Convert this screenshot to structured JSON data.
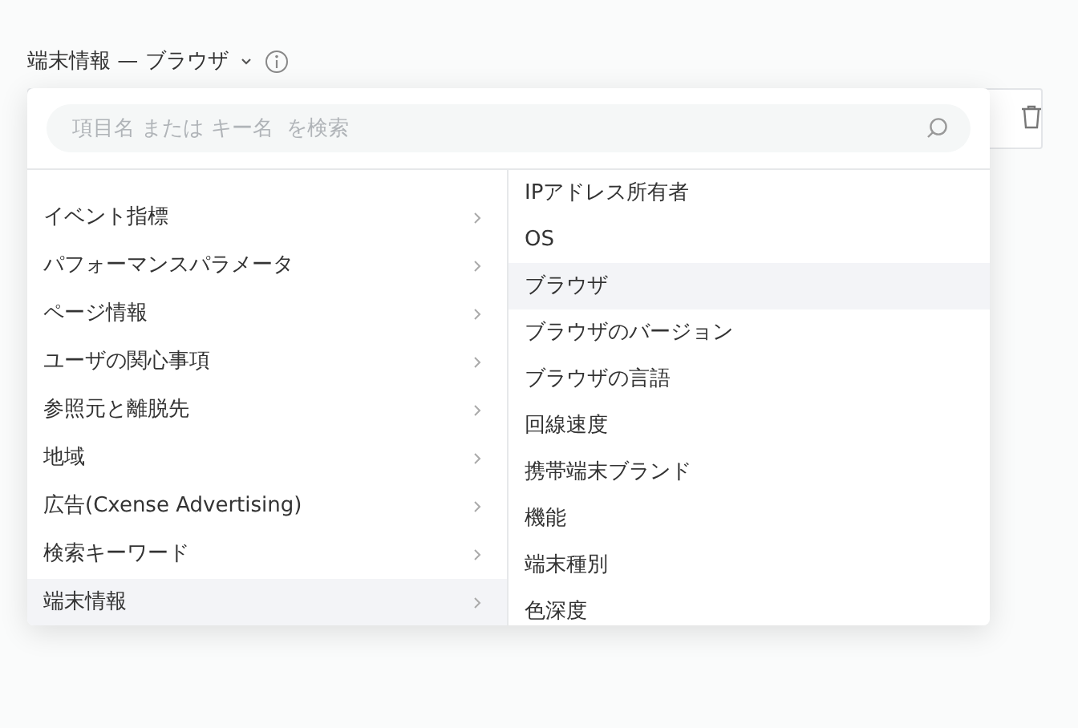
{
  "header": {
    "title": "端末情報 — ブラウザ"
  },
  "search": {
    "placeholder": "項目名 または キー名  を検索"
  },
  "categories": [
    {
      "label": "イベント指標",
      "selected": false
    },
    {
      "label": "パフォーマンスパラメータ",
      "selected": false
    },
    {
      "label": "ページ情報",
      "selected": false
    },
    {
      "label": "ユーザの関心事項",
      "selected": false
    },
    {
      "label": "参照元と離脱先",
      "selected": false
    },
    {
      "label": "地域",
      "selected": false
    },
    {
      "label": "広告(Cxense Advertising)",
      "selected": false
    },
    {
      "label": "検索キーワード",
      "selected": false
    },
    {
      "label": "端末情報",
      "selected": true
    }
  ],
  "fields": [
    {
      "label": "IPアドレス所有者",
      "selected": false
    },
    {
      "label": "OS",
      "selected": false
    },
    {
      "label": "ブラウザ",
      "selected": true
    },
    {
      "label": "ブラウザのバージョン",
      "selected": false
    },
    {
      "label": "ブラウザの言語",
      "selected": false
    },
    {
      "label": "回線速度",
      "selected": false
    },
    {
      "label": "携帯端末ブランド",
      "selected": false
    },
    {
      "label": "機能",
      "selected": false
    },
    {
      "label": "端末種別",
      "selected": false
    },
    {
      "label": "色深度",
      "selected": false
    }
  ]
}
